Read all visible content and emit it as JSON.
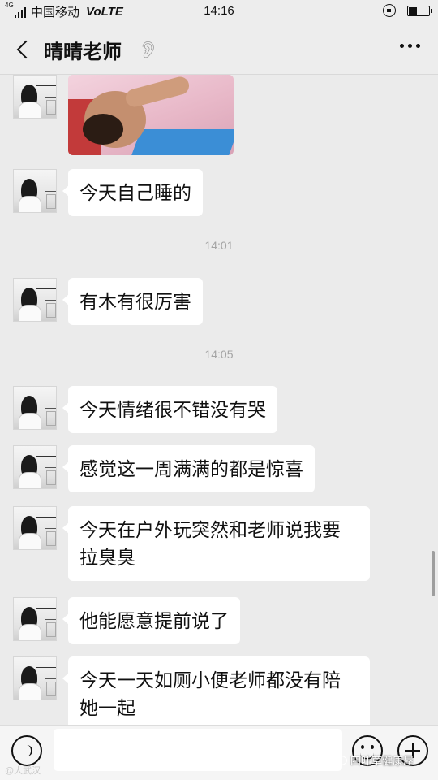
{
  "status": {
    "network_tag": "4G",
    "carrier": "中国移动",
    "volte": "VoLTE",
    "time": "14:16"
  },
  "nav": {
    "title": "晴晴老师"
  },
  "messages": [
    {
      "type": "text",
      "text": "今天自己睡的"
    },
    {
      "type": "time",
      "text": "14:01"
    },
    {
      "type": "text",
      "text": "有木有很厉害"
    },
    {
      "type": "time",
      "text": "14:05"
    },
    {
      "type": "text",
      "text": "今天情绪很不错没有哭"
    },
    {
      "type": "text",
      "text": "感觉这一周满满的都是惊喜"
    },
    {
      "type": "text",
      "text": "今天在户外玩突然和老师说我要拉臭臭"
    },
    {
      "type": "text",
      "text": "他能愿意提前说了"
    },
    {
      "type": "text",
      "text": "今天一天如厕小便老师都没有陪她一起"
    }
  ],
  "input": {
    "value": ""
  },
  "watermarks": {
    "left": "@大武汉",
    "right": "四叶草健康屋"
  }
}
